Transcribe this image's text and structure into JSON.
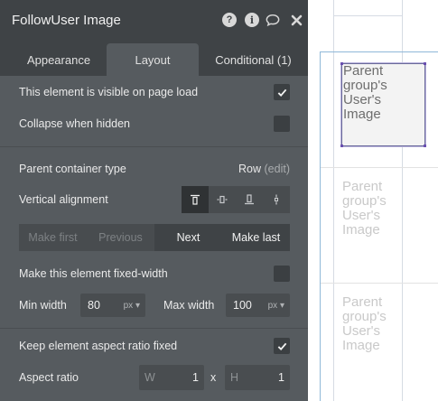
{
  "panel": {
    "title": "FollowUser Image",
    "tabs": [
      "Appearance",
      "Layout",
      "Conditional (1)"
    ],
    "visible_on_load_label": "This element is visible on page load",
    "visible_on_load_checked": true,
    "collapse_label": "Collapse when hidden",
    "collapse_checked": false,
    "parent_type_label": "Parent container type",
    "parent_type_value": "Row",
    "parent_type_edit": "(edit)",
    "vertical_alignment_label": "Vertical alignment",
    "order_buttons": {
      "make_first": "Make first",
      "previous": "Previous",
      "next": "Next",
      "make_last": "Make last"
    },
    "fixed_width_label": "Make this element fixed-width",
    "fixed_width_checked": false,
    "min_width_label": "Min width",
    "min_width_value": "80",
    "max_width_label": "Max width",
    "max_width_value": "100",
    "unit": "px",
    "aspect_fixed_label": "Keep element aspect ratio fixed",
    "aspect_fixed_checked": true,
    "aspect_ratio_label": "Aspect ratio",
    "aspect_w_placeholder": "W",
    "aspect_w_value": "1",
    "aspect_times": "x",
    "aspect_h_placeholder": "H",
    "aspect_h_value": "1"
  },
  "canvas": {
    "placeholder_text": "Parent\ngroup's\nUser's\nImage"
  }
}
